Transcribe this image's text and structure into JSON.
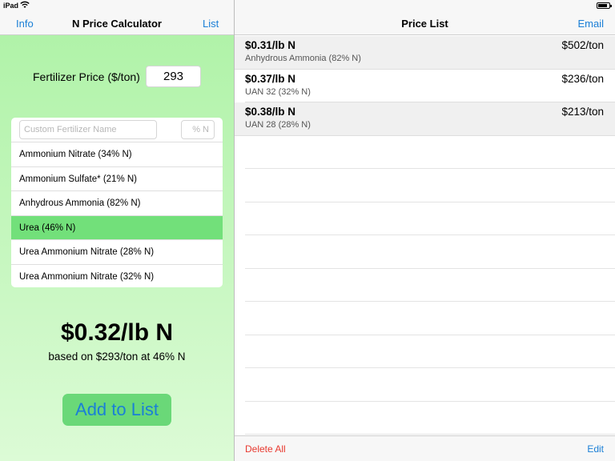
{
  "status_bar": {
    "device": "iPad"
  },
  "left_nav": {
    "info": "Info",
    "title": "N Price Calculator",
    "list": "List"
  },
  "price_input": {
    "label": "Fertilizer Price ($/ton)",
    "value": "293"
  },
  "custom": {
    "name_placeholder": "Custom Fertilizer Name",
    "pct_placeholder": "% N"
  },
  "fertilizers": [
    "Ammonium Nitrate (34% N)",
    "Ammonium Sulfate* (21% N)",
    "Anhydrous Ammonia (82% N)",
    "Urea (46% N)",
    "Urea Ammonium Nitrate (28% N)",
    "Urea Ammonium Nitrate (32% N)"
  ],
  "selected_fertilizer": "Urea (46% N)",
  "result": {
    "price": "$0.32/lb N",
    "basis": "based on $293/ton at 46% N"
  },
  "add_button": "Add to List",
  "right_nav": {
    "title": "Price List",
    "email": "Email"
  },
  "price_list": [
    {
      "per_lb": "$0.31/lb N",
      "name": "Anhydrous Ammonia (82% N)",
      "per_ton": "$502/ton"
    },
    {
      "per_lb": "$0.37/lb N",
      "name": "UAN 32 (32% N)",
      "per_ton": "$236/ton"
    },
    {
      "per_lb": "$0.38/lb N",
      "name": "UAN 28 (28% N)",
      "per_ton": "$213/ton"
    }
  ],
  "bottom_bar": {
    "delete_all": "Delete All",
    "edit": "Edit"
  },
  "colors": {
    "accent": "#1a7fd6",
    "selected_row": "#72e07a",
    "destructive": "#e8392f",
    "left_bg": "#c2f6bb"
  }
}
